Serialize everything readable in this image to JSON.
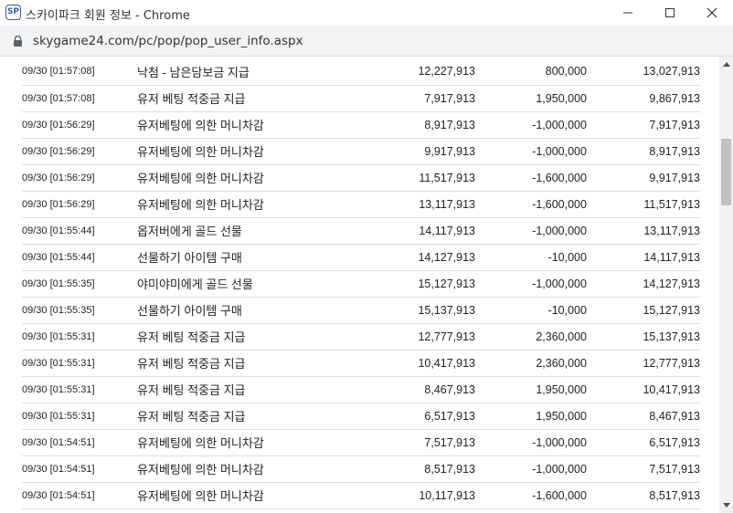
{
  "window": {
    "app_icon_text": "SP",
    "title": "스카이파크 회원 정보 - Chrome"
  },
  "address_bar": {
    "url": "skygame24.com/pc/pop/pop_user_info.aspx"
  },
  "rows": [
    {
      "time": "09/30 [01:57:08]",
      "desc": "낙첨 - 남은담보금 지급",
      "before": "12,227,913",
      "change": "800,000",
      "after": "13,027,913"
    },
    {
      "time": "09/30 [01:57:08]",
      "desc": "유저 베팅 적중금 지급",
      "before": "7,917,913",
      "change": "1,950,000",
      "after": "9,867,913"
    },
    {
      "time": "09/30 [01:56:29]",
      "desc": "유저베팅에 의한 머니차감",
      "before": "8,917,913",
      "change": "-1,000,000",
      "after": "7,917,913"
    },
    {
      "time": "09/30 [01:56:29]",
      "desc": "유저베팅에 의한 머니차감",
      "before": "9,917,913",
      "change": "-1,000,000",
      "after": "8,917,913"
    },
    {
      "time": "09/30 [01:56:29]",
      "desc": "유저베팅에 의한 머니차감",
      "before": "11,517,913",
      "change": "-1,600,000",
      "after": "9,917,913"
    },
    {
      "time": "09/30 [01:56:29]",
      "desc": "유저베팅에 의한 머니차감",
      "before": "13,117,913",
      "change": "-1,600,000",
      "after": "11,517,913"
    },
    {
      "time": "09/30 [01:55:44]",
      "desc": "옵저버에게 골드 선물",
      "before": "14,117,913",
      "change": "-1,000,000",
      "after": "13,117,913"
    },
    {
      "time": "09/30 [01:55:44]",
      "desc": "선물하기 아이템 구매",
      "before": "14,127,913",
      "change": "-10,000",
      "after": "14,117,913"
    },
    {
      "time": "09/30 [01:55:35]",
      "desc": "야미야미에게 골드 선물",
      "before": "15,127,913",
      "change": "-1,000,000",
      "after": "14,127,913"
    },
    {
      "time": "09/30 [01:55:35]",
      "desc": "선물하기 아이템 구매",
      "before": "15,137,913",
      "change": "-10,000",
      "after": "15,127,913"
    },
    {
      "time": "09/30 [01:55:31]",
      "desc": "유저 베팅 적중금 지급",
      "before": "12,777,913",
      "change": "2,360,000",
      "after": "15,137,913"
    },
    {
      "time": "09/30 [01:55:31]",
      "desc": "유저 베팅 적중금 지급",
      "before": "10,417,913",
      "change": "2,360,000",
      "after": "12,777,913"
    },
    {
      "time": "09/30 [01:55:31]",
      "desc": "유저 베팅 적중금 지급",
      "before": "8,467,913",
      "change": "1,950,000",
      "after": "10,417,913"
    },
    {
      "time": "09/30 [01:55:31]",
      "desc": "유저 베팅 적중금 지급",
      "before": "6,517,913",
      "change": "1,950,000",
      "after": "8,467,913"
    },
    {
      "time": "09/30 [01:54:51]",
      "desc": "유저베팅에 의한 머니차감",
      "before": "7,517,913",
      "change": "-1,000,000",
      "after": "6,517,913"
    },
    {
      "time": "09/30 [01:54:51]",
      "desc": "유저베팅에 의한 머니차감",
      "before": "8,517,913",
      "change": "-1,000,000",
      "after": "7,517,913"
    },
    {
      "time": "09/30 [01:54:51]",
      "desc": "유저베팅에 의한 머니차감",
      "before": "10,117,913",
      "change": "-1,600,000",
      "after": "8,517,913"
    }
  ]
}
